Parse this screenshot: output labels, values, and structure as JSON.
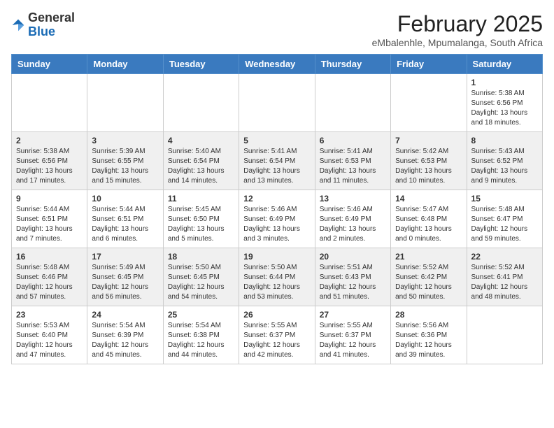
{
  "header": {
    "logo_general": "General",
    "logo_blue": "Blue",
    "title": "February 2025",
    "subtitle": "eMbalenhle, Mpumalanga, South Africa"
  },
  "weekdays": [
    "Sunday",
    "Monday",
    "Tuesday",
    "Wednesday",
    "Thursday",
    "Friday",
    "Saturday"
  ],
  "weeks": [
    [
      {
        "day": "",
        "info": ""
      },
      {
        "day": "",
        "info": ""
      },
      {
        "day": "",
        "info": ""
      },
      {
        "day": "",
        "info": ""
      },
      {
        "day": "",
        "info": ""
      },
      {
        "day": "",
        "info": ""
      },
      {
        "day": "1",
        "info": "Sunrise: 5:38 AM\nSunset: 6:56 PM\nDaylight: 13 hours\nand 18 minutes."
      }
    ],
    [
      {
        "day": "2",
        "info": "Sunrise: 5:38 AM\nSunset: 6:56 PM\nDaylight: 13 hours\nand 17 minutes."
      },
      {
        "day": "3",
        "info": "Sunrise: 5:39 AM\nSunset: 6:55 PM\nDaylight: 13 hours\nand 15 minutes."
      },
      {
        "day": "4",
        "info": "Sunrise: 5:40 AM\nSunset: 6:54 PM\nDaylight: 13 hours\nand 14 minutes."
      },
      {
        "day": "5",
        "info": "Sunrise: 5:41 AM\nSunset: 6:54 PM\nDaylight: 13 hours\nand 13 minutes."
      },
      {
        "day": "6",
        "info": "Sunrise: 5:41 AM\nSunset: 6:53 PM\nDaylight: 13 hours\nand 11 minutes."
      },
      {
        "day": "7",
        "info": "Sunrise: 5:42 AM\nSunset: 6:53 PM\nDaylight: 13 hours\nand 10 minutes."
      },
      {
        "day": "8",
        "info": "Sunrise: 5:43 AM\nSunset: 6:52 PM\nDaylight: 13 hours\nand 9 minutes."
      }
    ],
    [
      {
        "day": "9",
        "info": "Sunrise: 5:44 AM\nSunset: 6:51 PM\nDaylight: 13 hours\nand 7 minutes."
      },
      {
        "day": "10",
        "info": "Sunrise: 5:44 AM\nSunset: 6:51 PM\nDaylight: 13 hours\nand 6 minutes."
      },
      {
        "day": "11",
        "info": "Sunrise: 5:45 AM\nSunset: 6:50 PM\nDaylight: 13 hours\nand 5 minutes."
      },
      {
        "day": "12",
        "info": "Sunrise: 5:46 AM\nSunset: 6:49 PM\nDaylight: 13 hours\nand 3 minutes."
      },
      {
        "day": "13",
        "info": "Sunrise: 5:46 AM\nSunset: 6:49 PM\nDaylight: 13 hours\nand 2 minutes."
      },
      {
        "day": "14",
        "info": "Sunrise: 5:47 AM\nSunset: 6:48 PM\nDaylight: 13 hours\nand 0 minutes."
      },
      {
        "day": "15",
        "info": "Sunrise: 5:48 AM\nSunset: 6:47 PM\nDaylight: 12 hours\nand 59 minutes."
      }
    ],
    [
      {
        "day": "16",
        "info": "Sunrise: 5:48 AM\nSunset: 6:46 PM\nDaylight: 12 hours\nand 57 minutes."
      },
      {
        "day": "17",
        "info": "Sunrise: 5:49 AM\nSunset: 6:45 PM\nDaylight: 12 hours\nand 56 minutes."
      },
      {
        "day": "18",
        "info": "Sunrise: 5:50 AM\nSunset: 6:45 PM\nDaylight: 12 hours\nand 54 minutes."
      },
      {
        "day": "19",
        "info": "Sunrise: 5:50 AM\nSunset: 6:44 PM\nDaylight: 12 hours\nand 53 minutes."
      },
      {
        "day": "20",
        "info": "Sunrise: 5:51 AM\nSunset: 6:43 PM\nDaylight: 12 hours\nand 51 minutes."
      },
      {
        "day": "21",
        "info": "Sunrise: 5:52 AM\nSunset: 6:42 PM\nDaylight: 12 hours\nand 50 minutes."
      },
      {
        "day": "22",
        "info": "Sunrise: 5:52 AM\nSunset: 6:41 PM\nDaylight: 12 hours\nand 48 minutes."
      }
    ],
    [
      {
        "day": "23",
        "info": "Sunrise: 5:53 AM\nSunset: 6:40 PM\nDaylight: 12 hours\nand 47 minutes."
      },
      {
        "day": "24",
        "info": "Sunrise: 5:54 AM\nSunset: 6:39 PM\nDaylight: 12 hours\nand 45 minutes."
      },
      {
        "day": "25",
        "info": "Sunrise: 5:54 AM\nSunset: 6:38 PM\nDaylight: 12 hours\nand 44 minutes."
      },
      {
        "day": "26",
        "info": "Sunrise: 5:55 AM\nSunset: 6:37 PM\nDaylight: 12 hours\nand 42 minutes."
      },
      {
        "day": "27",
        "info": "Sunrise: 5:55 AM\nSunset: 6:37 PM\nDaylight: 12 hours\nand 41 minutes."
      },
      {
        "day": "28",
        "info": "Sunrise: 5:56 AM\nSunset: 6:36 PM\nDaylight: 12 hours\nand 39 minutes."
      },
      {
        "day": "",
        "info": ""
      }
    ]
  ]
}
